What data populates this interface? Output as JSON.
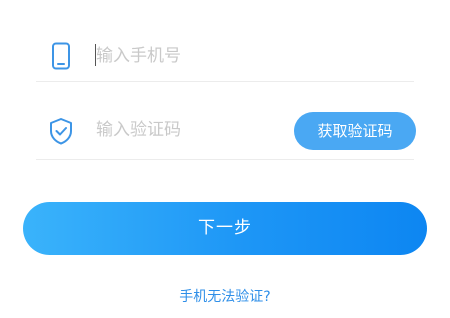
{
  "phone_field": {
    "placeholder": "输入手机号",
    "value": "",
    "icon": "phone-icon"
  },
  "code_field": {
    "placeholder": "输入验证码",
    "value": "",
    "icon": "shield-check-icon"
  },
  "get_code_button": {
    "label": "获取验证码",
    "color": "#4aa8f3"
  },
  "next_button": {
    "label": "下一步",
    "gradient_start": "#3ab3fb",
    "gradient_end": "#0d86f2"
  },
  "cannot_verify_link": {
    "label": "手机无法验证?"
  },
  "colors": {
    "accent": "#2f8fe8",
    "divider": "#ececec",
    "placeholder": "#c9c9c9"
  }
}
